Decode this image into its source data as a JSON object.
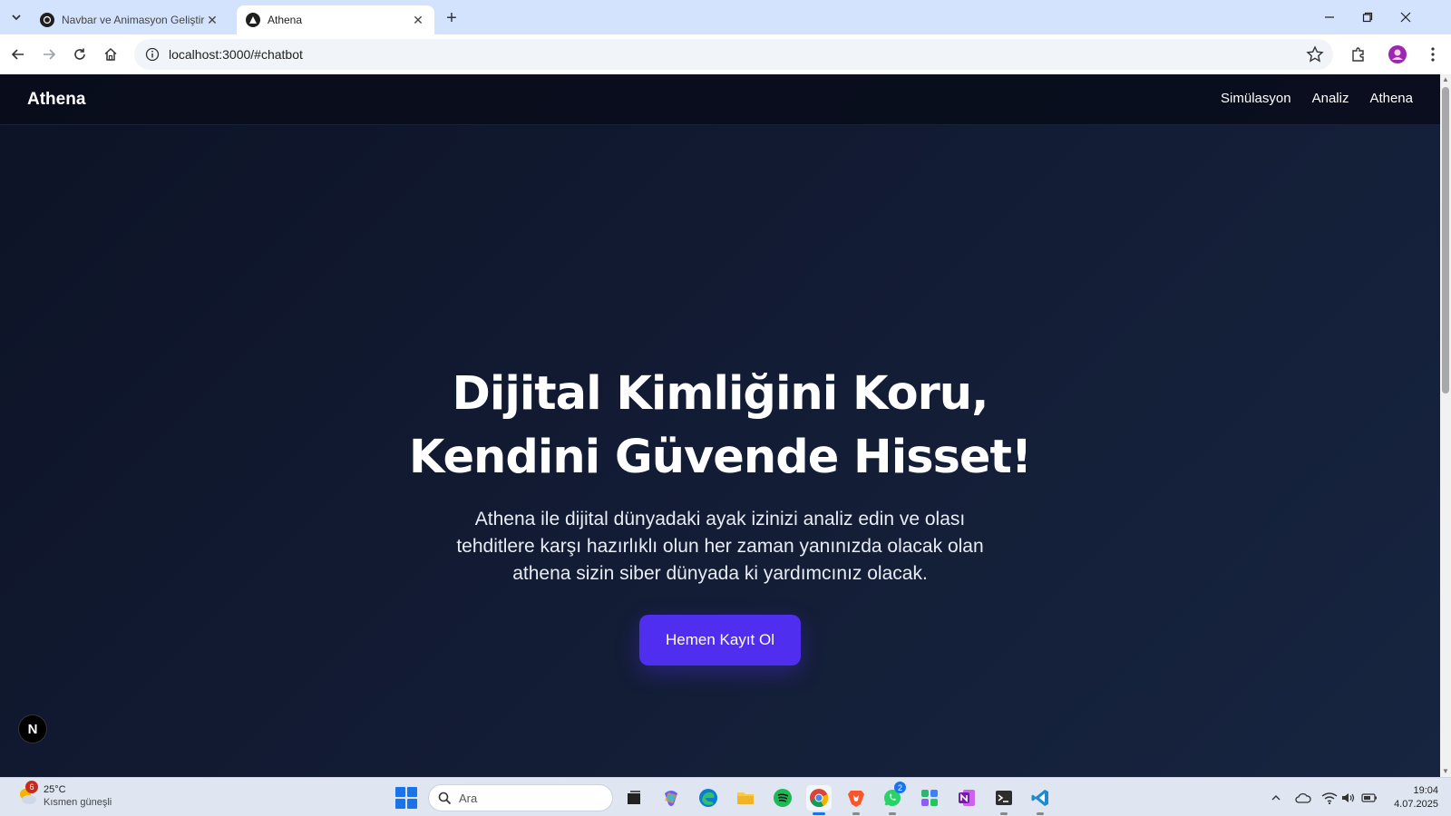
{
  "browser": {
    "tabs": [
      {
        "title": "Navbar ve Animasyon Geliştirm",
        "active": false
      },
      {
        "title": "Athena",
        "active": true
      }
    ],
    "url": "localhost:3000/#chatbot"
  },
  "site": {
    "brand": "Athena",
    "nav": [
      "Simülasyon",
      "Analiz",
      "Athena"
    ],
    "hero": {
      "title_line1": "Dijital Kimliğini Koru,",
      "title_line2": "Kendini Güvende Hisset!",
      "subtitle": "Athena ile dijital dünyadaki ayak izinizi analiz edin ve olası tehditlere karşı hazırlıklı olun her zaman yanınızda olacak olan athena sizin siber dünyada ki yardımcınız olacak.",
      "cta": "Hemen Kayıt Ol"
    },
    "dev_badge": "N",
    "colors": {
      "accent": "#4f2ef0",
      "background": "#0f172a"
    }
  },
  "taskbar": {
    "weather": {
      "badge": "6",
      "temp": "25°C",
      "condition": "Kısmen güneşli"
    },
    "search_placeholder": "Ara",
    "whatsapp_badge": "2",
    "time": "19:04",
    "date": "4.07.2025",
    "apps": [
      "task-view",
      "copilot",
      "edge",
      "file-explorer",
      "spotify",
      "chrome",
      "brave",
      "whatsapp",
      "app-grid",
      "onenote",
      "terminal",
      "vscode"
    ]
  }
}
